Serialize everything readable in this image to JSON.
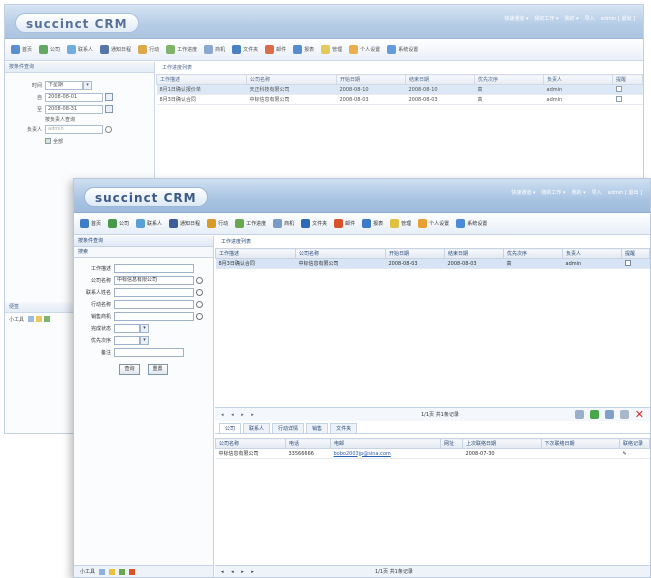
{
  "app": {
    "logo": "succinct CRM"
  },
  "toplinks": [
    "快速通道 ▾",
    "我的工作 ▾",
    "我的 ▾",
    "导入",
    "admin [ 退出 ]"
  ],
  "toolbar": [
    {
      "label": "首页",
      "color": "#3d7dc8"
    },
    {
      "label": "公司",
      "color": "#4a9a4a"
    },
    {
      "label": "联系人",
      "color": "#5aa0d8"
    },
    {
      "label": "通知日程",
      "color": "#3a5f9a"
    },
    {
      "label": "行动",
      "color": "#d89a2a"
    },
    {
      "label": "工作进度",
      "color": "#6aa84f"
    },
    {
      "label": "商机",
      "color": "#7a9ac8"
    },
    {
      "label": "文件夹",
      "color": "#2a6ab8"
    },
    {
      "label": "邮件",
      "color": "#d8522a"
    },
    {
      "label": "报表",
      "color": "#3a7ac8"
    },
    {
      "label": "管理",
      "color": "#e0c040"
    },
    {
      "label": "个人设置",
      "color": "#e8a030"
    },
    {
      "label": "系统设置",
      "color": "#4a8ad8"
    }
  ],
  "back": {
    "left_title": "按条件查询",
    "period_label": "时间",
    "period_value": "下星期",
    "from_label": "自",
    "from_value": "2008-08-01",
    "to_label": "至",
    "to_value": "2008-08-31",
    "owner_label": "按负责人查询",
    "owner_field": "负责人",
    "owner_value": "admin",
    "all_label": "全部",
    "list_title": "工作进度列表",
    "columns": [
      "工作描述",
      "公司名称",
      "开始日期",
      "结束日期",
      "优先次序",
      "负责人",
      "提醒"
    ],
    "rows": [
      [
        "8月1日确认报价单",
        "天正科技有限公司",
        "2008-08-10",
        "2008-08-10",
        "高",
        "admin",
        ""
      ],
      [
        "8月3日确认合同",
        "中标信息有限公司",
        "2008-08-03",
        "2008-08-03",
        "高",
        "admin",
        ""
      ]
    ]
  },
  "front": {
    "left_title": "按条件查询",
    "search_title": "搜索",
    "fields": [
      {
        "label": "工作描述",
        "value": ""
      },
      {
        "label": "公司名称",
        "value": "中标信息有限公司"
      },
      {
        "label": "联系人姓名",
        "value": ""
      },
      {
        "label": "行动名称",
        "value": ""
      },
      {
        "label": "销售商机",
        "value": ""
      },
      {
        "label": "完成状态",
        "value": ""
      },
      {
        "label": "优先次序",
        "value": ""
      },
      {
        "label": "备注",
        "value": ""
      }
    ],
    "search_btn": "查询",
    "reset_btn": "重置",
    "list_title": "工作进度列表",
    "columns": [
      "工作描述",
      "公司名称",
      "开始日期",
      "结束日期",
      "优先次序",
      "负责人",
      "提醒"
    ],
    "rows": [
      [
        "8月3日确认合同",
        "中标信息有限公司",
        "2008-08-03",
        "2008-08-03",
        "高",
        "admin",
        ""
      ]
    ],
    "pager_arrows": "◂ ◂ ▸ ▸",
    "pager_text": "1/1页 共1条记录",
    "subtabs": [
      "公司",
      "联系人",
      "行动详情",
      "销售",
      "文件夹"
    ],
    "detail_columns": [
      "公司名称",
      "电话",
      "电邮",
      "网址",
      "上次联络日期",
      "下次联络日期",
      "联络记录"
    ],
    "detail_rows": [
      [
        "中标信息有限公司",
        "33566666",
        "bobo2003jp@sina.com",
        "",
        "2008-07-30",
        "",
        "✎"
      ]
    ],
    "status_left": "小工具",
    "pager2_text": "1/1页 共1条记录"
  },
  "back_side": {
    "mini_title": "便签",
    "tools": "小工具"
  }
}
